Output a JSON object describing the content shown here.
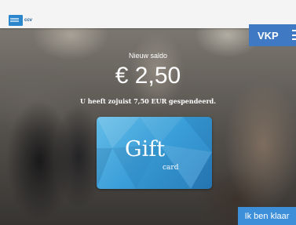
{
  "header": {
    "logo_text": "ccv",
    "user_badge": "VKP"
  },
  "balance": {
    "label": "Nieuw saldo",
    "amount": "€ 2,50",
    "spent_message": "U heeft zojuist 7,50 EUR gespendeerd."
  },
  "giftcard": {
    "word_gift": "Gift",
    "word_card": "card"
  },
  "actions": {
    "done_label": "Ik ben klaar"
  },
  "colors": {
    "accent": "#3c8fd8",
    "badge": "#3f78c3",
    "card": "#3a9ed8"
  }
}
